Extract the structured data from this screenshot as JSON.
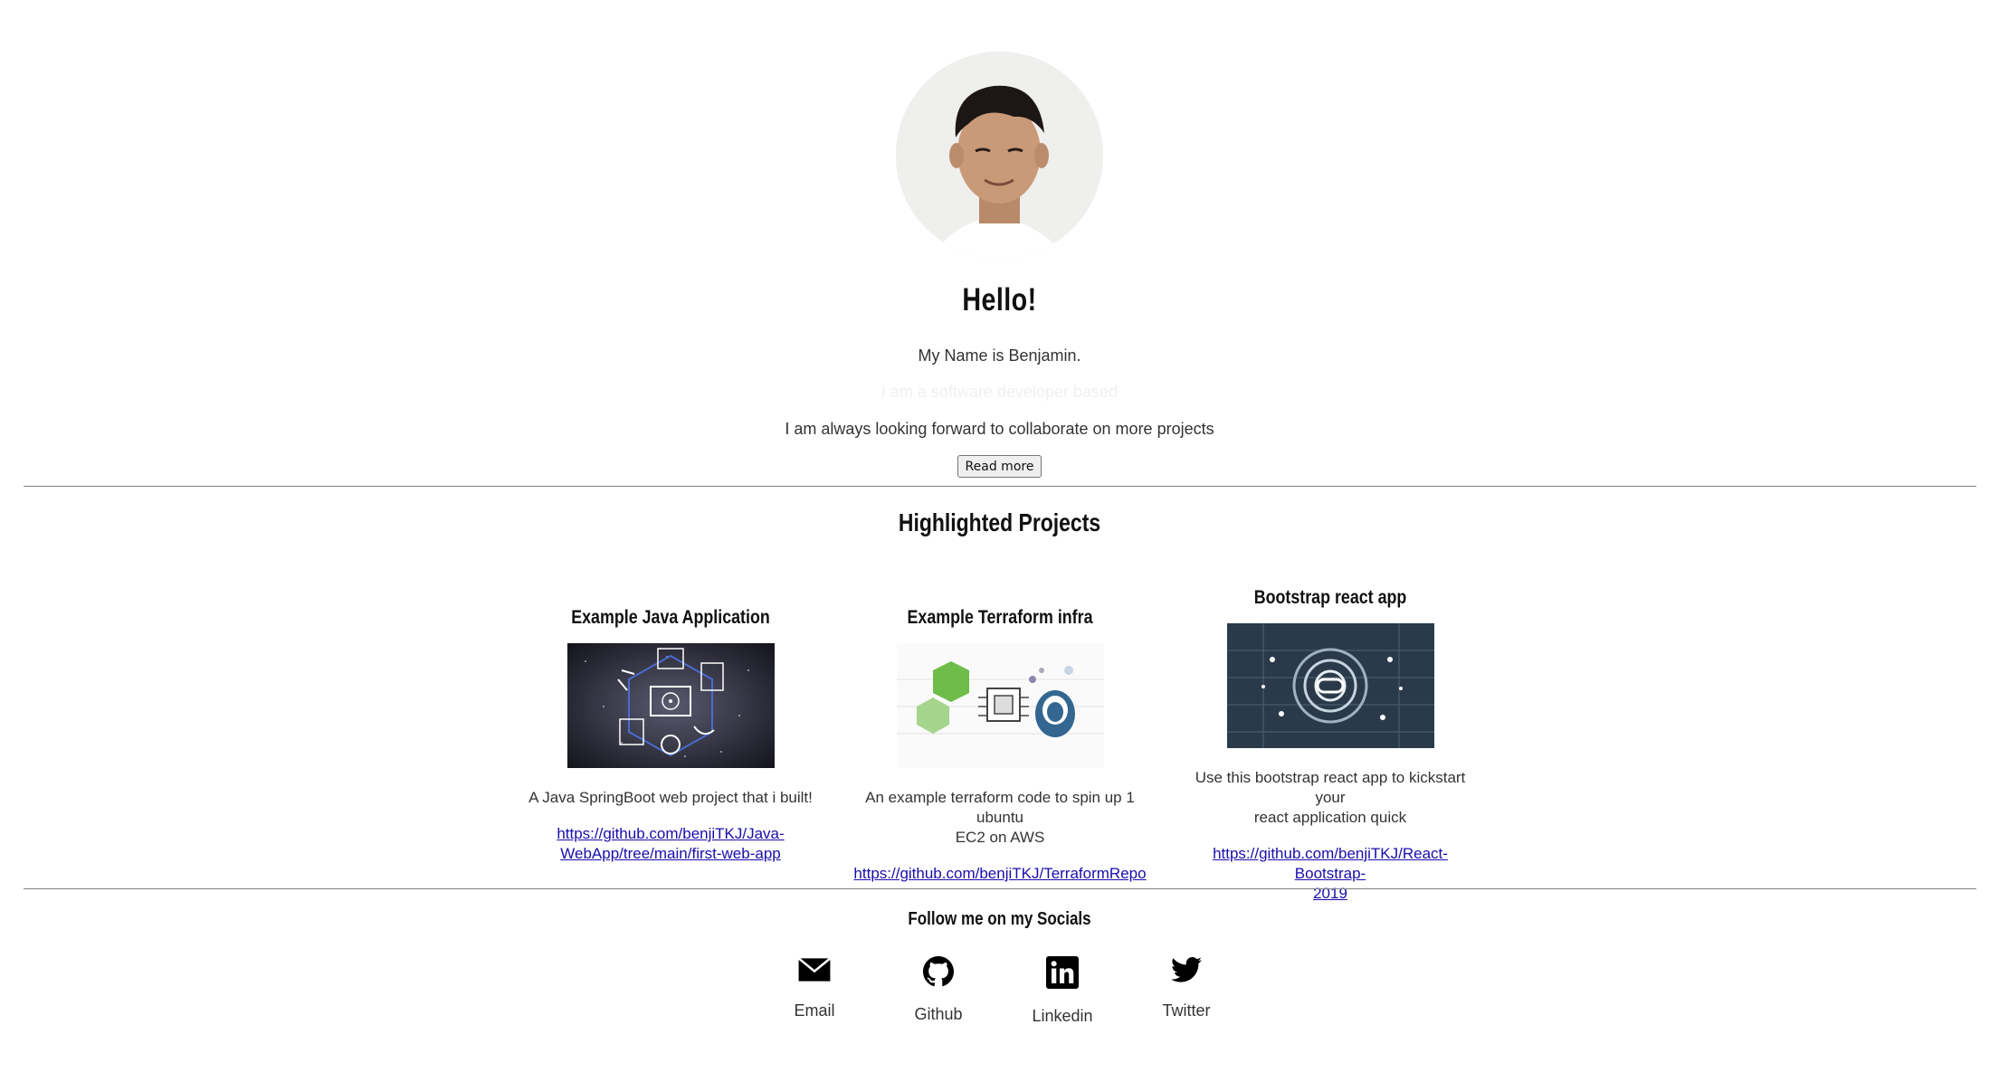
{
  "hero": {
    "greeting": "Hello!",
    "intro": "My Name is Benjamin.",
    "faded_line": "I am a software developer based",
    "collab": "I am always looking forward to collaborate on more projects",
    "read_more": "Read more"
  },
  "projects": {
    "title": "Highlighted Projects",
    "items": [
      {
        "title": "Example Java Application",
        "description": "A Java SpringBoot web project that i built!",
        "link_line1": "https://github.com/benjiTKJ/Java-",
        "link_line2": "WebApp/tree/main/first-web-app"
      },
      {
        "title": "Example Terraform infra",
        "description_line1": "An example terraform code to spin up 1 ubuntu",
        "description_line2": "EC2 on AWS",
        "link": "https://github.com/benjiTKJ/TerraformRepo"
      },
      {
        "title": "Bootstrap react app",
        "description_line1": "Use this bootstrap react app to kickstart your",
        "description_line2": "react application quick",
        "link_line1": "https://github.com/benjiTKJ/React-Bootstrap-",
        "link_line2": "2019"
      }
    ]
  },
  "socials": {
    "title": "Follow me on my Socials",
    "items": [
      {
        "label": "Email",
        "icon": "mail-icon"
      },
      {
        "label": "Github",
        "icon": "github-icon"
      },
      {
        "label": "Linkedin",
        "icon": "linkedin-icon"
      },
      {
        "label": "Twitter",
        "icon": "twitter-icon"
      }
    ]
  },
  "colors": {
    "link": "#1a0dab",
    "divider": "#808080",
    "text": "#333333"
  }
}
